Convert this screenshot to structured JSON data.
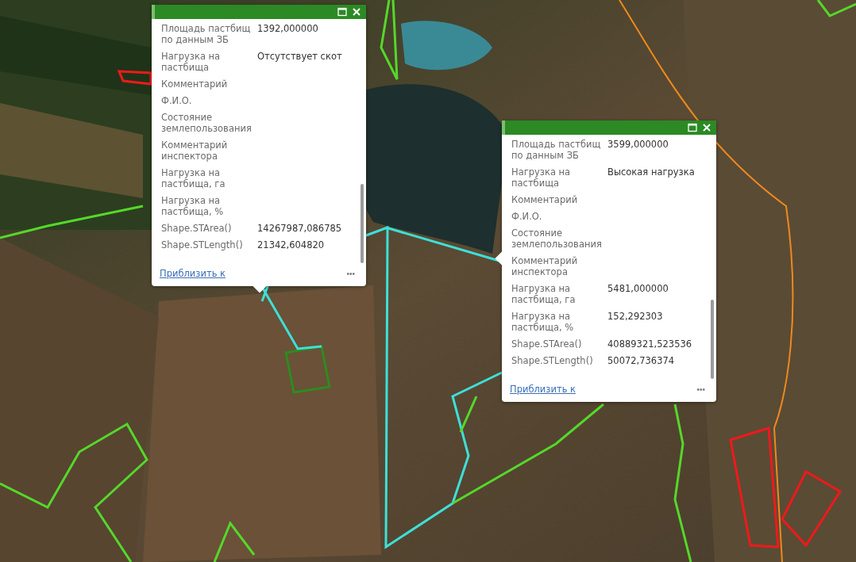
{
  "popups": [
    {
      "fields": [
        {
          "label": "Площадь пастбищ по данным ЗБ",
          "value": "1392,000000"
        },
        {
          "label": "Нагрузка на пастбища",
          "value": "Отсутствует скот"
        },
        {
          "label": "Комментарий"
        },
        {
          "label": "Ф.И.О."
        },
        {
          "label": "Состояние землепользования"
        },
        {
          "label": "Комментарий инспектора"
        },
        {
          "label": "Нагрузка на пастбища, га"
        },
        {
          "label": "Нагрузка на пастбища, %"
        },
        {
          "label": "Shape.STArea()",
          "value": "14267987,086785"
        },
        {
          "label": "Shape.STLength()",
          "value": "21342,604820"
        }
      ],
      "zoom_link": "Приблизить к",
      "more": "•••"
    },
    {
      "fields": [
        {
          "label": "Площадь пастбищ по данным ЗБ",
          "value": "3599,000000"
        },
        {
          "label": "Нагрузка на пастбища",
          "value": "Высокая нагрузка"
        },
        {
          "label": "Комментарий"
        },
        {
          "label": "Ф.И.О."
        },
        {
          "label": "Состояние землепользования"
        },
        {
          "label": "Комментарий инспектора"
        },
        {
          "label": "Нагрузка на пастбища, га",
          "value": "5481,000000"
        },
        {
          "label": "Нагрузка на пастбища, %",
          "value": "152,292303"
        },
        {
          "label": "Shape.STArea()",
          "value": "40889321,523536"
        },
        {
          "label": "Shape.STLength()",
          "value": "50072,736374"
        }
      ],
      "zoom_link": "Приблизить к",
      "more": "•••"
    }
  ]
}
